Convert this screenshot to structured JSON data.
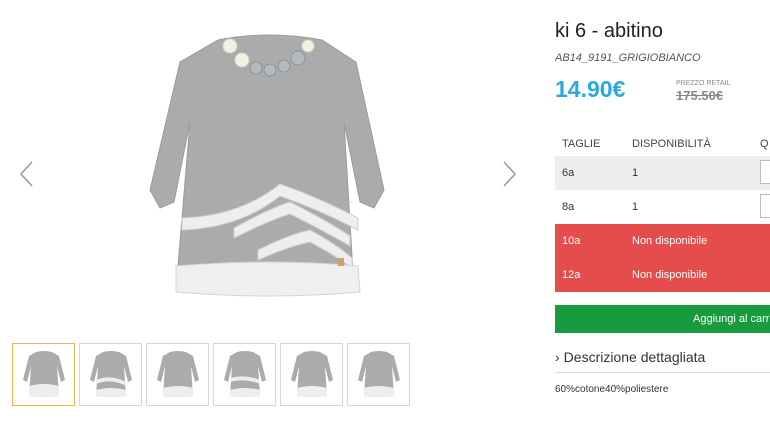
{
  "gallery": {
    "prev_icon": "chevron-left-icon",
    "next_icon": "chevron-right-icon",
    "thumbnail_count": 6,
    "active_thumbnail": 1,
    "active_border_color": "#f0b44c"
  },
  "product": {
    "title": "ki 6 - abitino",
    "sku": "AB14_9191_GRIGIOBIANCO",
    "price": "14.90€",
    "retail_label": "PREZZO RETAIL",
    "retail_price": "175.50€",
    "price_color": "#2ba8e0"
  },
  "size_table": {
    "headers": [
      "TAGLIE",
      "DISPONIBILITÀ",
      "Q"
    ],
    "rows": [
      {
        "size": "6a",
        "availability": "1"
      },
      {
        "size": "8a",
        "availability": "1"
      },
      {
        "size": "10a",
        "availability": "Non disponibile"
      },
      {
        "size": "12a",
        "availability": "Non disponibile"
      }
    ],
    "unavailable_color": "#e54c4c"
  },
  "cart": {
    "label": "Aggiungi al carr",
    "color": "#189a3f"
  },
  "description": {
    "toggle_label": "Descrizione dettagliata",
    "composition": "60%cotone40%poliestere"
  }
}
